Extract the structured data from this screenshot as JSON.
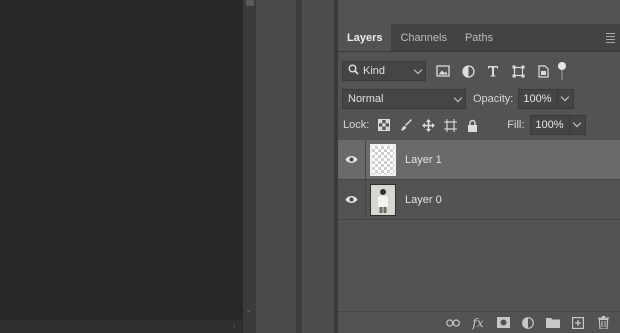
{
  "colors": {
    "panel_bg": "#535353",
    "canvas_bg": "#282828",
    "selected_row": "#6a6a6a",
    "tab_bar": "#434343"
  },
  "tabs": [
    {
      "label": "Layers",
      "active": true
    },
    {
      "label": "Channels",
      "active": false
    },
    {
      "label": "Paths",
      "active": false
    }
  ],
  "filter": {
    "kind_label": "Kind",
    "icons": [
      "pixel-filter-icon",
      "adjustment-filter-icon",
      "type-filter-icon",
      "shape-filter-icon",
      "smart-object-filter-icon",
      "filter-toggle"
    ]
  },
  "blend": {
    "mode": "Normal",
    "opacity_label": "Opacity:",
    "opacity_value": "100%"
  },
  "lock": {
    "label": "Lock:",
    "icons": [
      "lock-transparent-pixels-icon",
      "lock-image-pixels-icon",
      "lock-position-icon",
      "lock-artboard-icon",
      "lock-all-icon"
    ],
    "fill_label": "Fill:",
    "fill_value": "100%"
  },
  "layers": [
    {
      "name": "Layer 1",
      "visible": true,
      "selected": true,
      "thumbnail": "transparent"
    },
    {
      "name": "Layer 0",
      "visible": true,
      "selected": false,
      "thumbnail": "photo"
    }
  ],
  "footer": {
    "icons": [
      "link-layers-icon",
      "fx-icon",
      "layer-mask-icon",
      "adjustment-layer-icon",
      "group-folder-icon",
      "new-layer-icon",
      "trash-icon"
    ],
    "fx_label": "fx"
  }
}
